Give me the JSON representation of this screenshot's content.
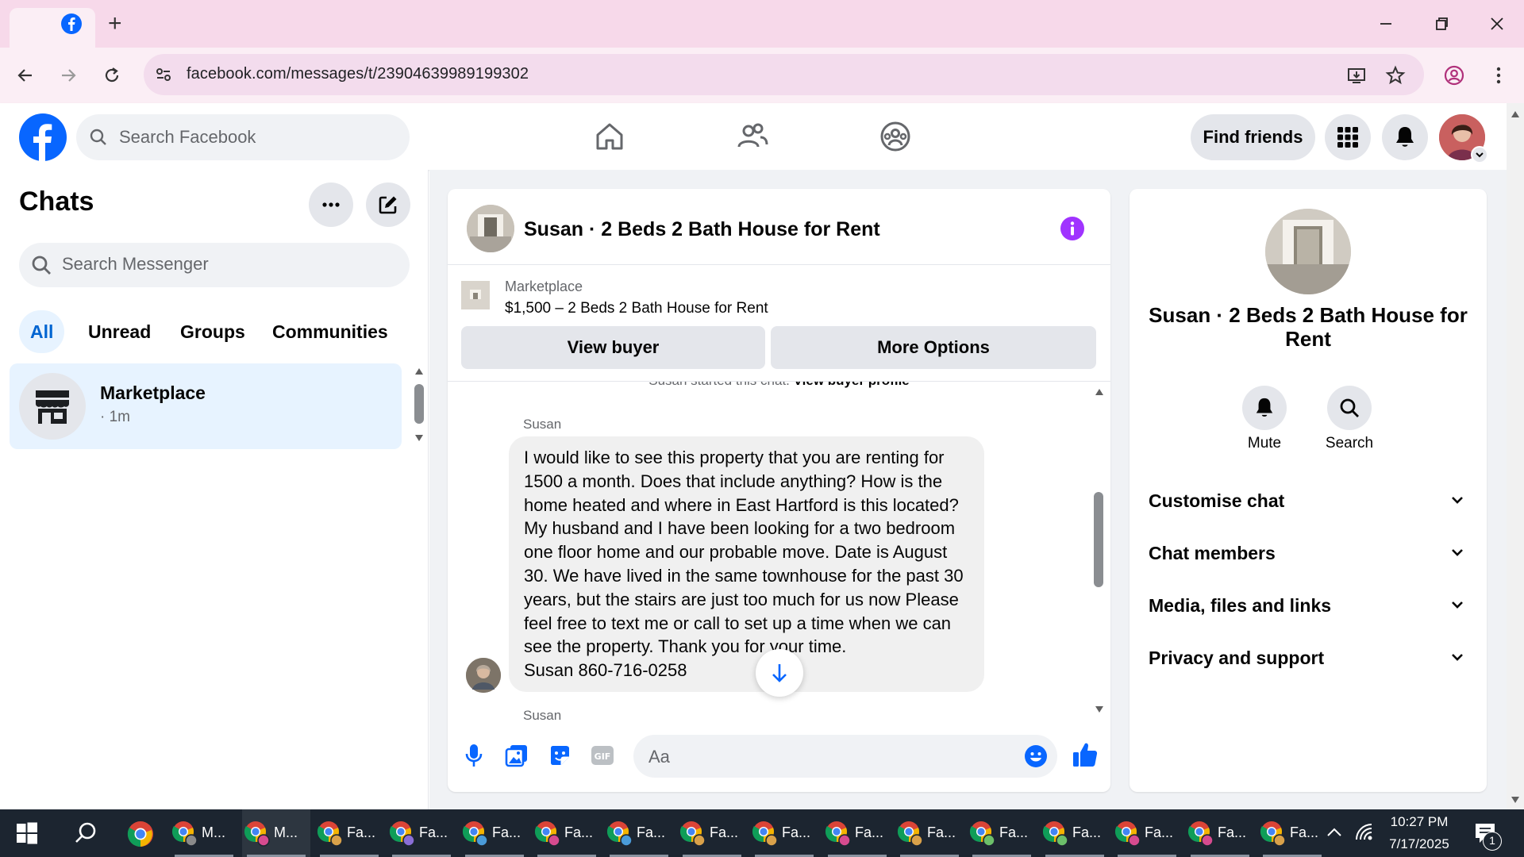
{
  "browser": {
    "url": "facebook.com/messages/t/23904639989199302",
    "new_tab_symbol": "+"
  },
  "fb_header": {
    "search_placeholder": "Search Facebook",
    "find_friends_label": "Find friends"
  },
  "sidebar": {
    "title": "Chats",
    "search_placeholder": "Search Messenger",
    "filters": [
      "All",
      "Unread",
      "Groups",
      "Communities"
    ],
    "active_filter": "All",
    "chats": [
      {
        "name": "Marketplace",
        "time": "· 1m"
      }
    ]
  },
  "conversation": {
    "title": "Susan · 2 Beds 2 Bath House for Rent",
    "marketplace_label": "Marketplace",
    "listing": "$1,500 – 2 Beds 2 Bath House for Rent",
    "view_buyer_label": "View buyer",
    "more_options_label": "More Options",
    "started_text": "Susan started this chat.",
    "view_profile_label": "View buyer profile",
    "messages": [
      {
        "sender": "Susan",
        "text": "I would like to see this property that you are renting for\n1500 a month. Does that include anything?  How is the\nhome heated and where in East Hartford is this located?\nMy husband and I have been looking for a two bedroom\none floor home and our probable move. Date is August\n30. We have lived in the same townhouse for the past 30\nyears, but the stairs are just too much for us now Please\nfeel free to text me or call to set up a time when we can\nsee the property. Thank you for your time.\nSusan   860-716-0258"
      }
    ],
    "next_sender": "Susan",
    "composer_placeholder": "Aa"
  },
  "details": {
    "title": "Susan · 2 Beds 2 Bath House for Rent",
    "actions": [
      "Mute",
      "Search"
    ],
    "sections": [
      "Customise chat",
      "Chat members",
      "Media, files and links",
      "Privacy and support"
    ]
  },
  "taskbar": {
    "items": [
      {
        "label": "M...",
        "icon": "chrome-icon"
      },
      {
        "label": "M...",
        "icon": "chrome-icon"
      },
      {
        "label": "Fa...",
        "icon": "chrome-icon"
      },
      {
        "label": "Fa...",
        "icon": "chrome-icon"
      },
      {
        "label": "Fa...",
        "icon": "chrome-icon"
      },
      {
        "label": "Fa...",
        "icon": "chrome-icon"
      },
      {
        "label": "Fa...",
        "icon": "chrome-icon"
      },
      {
        "label": "Fa...",
        "icon": "chrome-icon"
      },
      {
        "label": "Fa...",
        "icon": "chrome-icon"
      },
      {
        "label": "Fa...",
        "icon": "chrome-icon"
      },
      {
        "label": "Fa...",
        "icon": "chrome-icon"
      },
      {
        "label": "Fa...",
        "icon": "chrome-icon"
      },
      {
        "label": "Fa...",
        "icon": "chrome-icon"
      },
      {
        "label": "Fa...",
        "icon": "chrome-icon"
      },
      {
        "label": "Fa...",
        "icon": "chrome-icon"
      },
      {
        "label": "Fa...",
        "icon": "chrome-icon"
      }
    ],
    "time": "10:27 PM",
    "date": "7/17/2025",
    "notification_count": "1"
  },
  "colors": {
    "fb_blue": "#0866ff",
    "messenger_purple": "#a033ff",
    "tab_bar": "#f7d9ea",
    "taskbar": "#1c2530"
  }
}
